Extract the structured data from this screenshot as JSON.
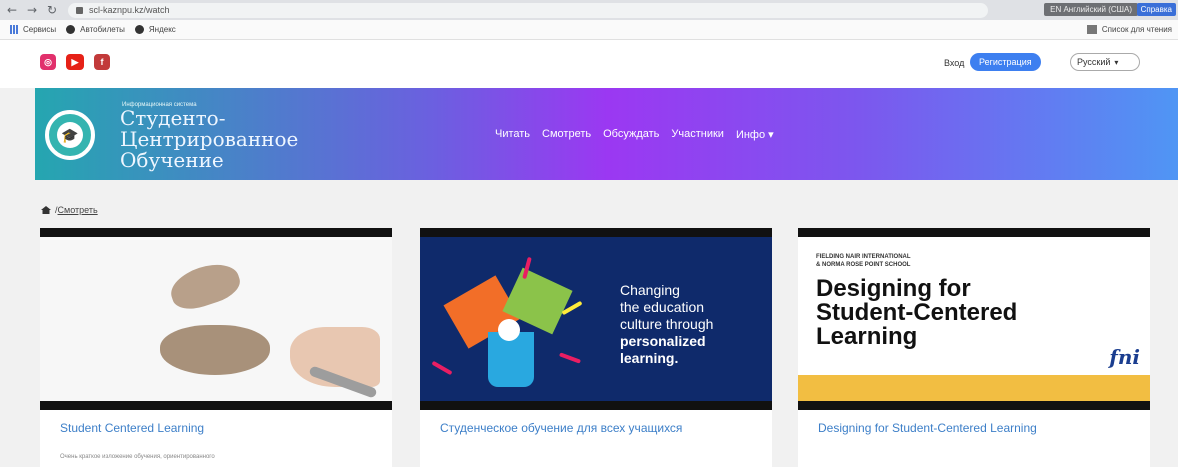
{
  "browser": {
    "url": "scl-kaznpu.kz/watch",
    "translate": "EN Английский (США)",
    "help": "Справка",
    "bookmarks": [
      "Сервисы",
      "Автобилеты",
      "Яндекс"
    ],
    "reading_list": "Список для чтения"
  },
  "topbar": {
    "login": "Вход",
    "register": "Регистрация",
    "language": "Русский"
  },
  "header": {
    "system_caption": "Информационная система",
    "logo_line1": "Студенто-",
    "logo_line2": "Центрированное",
    "logo_line3": "Обучение",
    "nav": [
      "Читать",
      "Смотреть",
      "Обсуждать",
      "Участники",
      "Инфо ▾"
    ]
  },
  "breadcrumb": {
    "current": "Смотреть"
  },
  "cards": [
    {
      "title": "Student Centered Learning",
      "desc": "Очень краткое изложение обучения, ориентированного"
    },
    {
      "title": "Студенческое обучение для всех учащихся",
      "image_text": [
        "Changing",
        "the education",
        "culture through",
        "personalized",
        "learning."
      ]
    },
    {
      "title": "Designing for Student-Centered Learning",
      "image_small": [
        "FIELDING NAIR INTERNATIONAL",
        "& NORMA ROSE POINT SCHOOL"
      ],
      "image_big": [
        "Designing for",
        "Student-Centered",
        "Learning"
      ],
      "image_logo": "fni"
    }
  ],
  "colors": {
    "accent": "#3d7ff0",
    "title_link": "#3d7fc8"
  }
}
